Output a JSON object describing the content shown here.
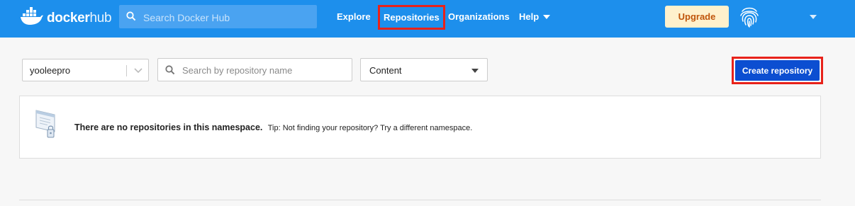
{
  "header": {
    "logo_bold": "docker",
    "logo_light": "hub",
    "search_placeholder": "Search Docker Hub",
    "nav": {
      "explore": "Explore",
      "repositories": "Repositories",
      "organizations": "Organizations",
      "help": "Help"
    },
    "upgrade_label": "Upgrade",
    "icons": [
      "docker-whale-icon",
      "search-icon",
      "chevron-down-icon",
      "fingerprint-avatar-icon"
    ]
  },
  "toolbar": {
    "namespace_value": "yooleepro",
    "repo_search_placeholder": "Search by repository name",
    "content_filter_value": "Content",
    "create_repository_label": "Create repository"
  },
  "empty_state": {
    "message": "There are no repositories in this namespace.",
    "tip": "Tip: Not finding your repository? Try a different namespace."
  },
  "colors": {
    "header_bg": "#1d8fec",
    "primary_button": "#0c4ed1",
    "upgrade_bg": "#fff1cc",
    "upgrade_text": "#c0550b",
    "highlight_outline": "#e8221a"
  }
}
